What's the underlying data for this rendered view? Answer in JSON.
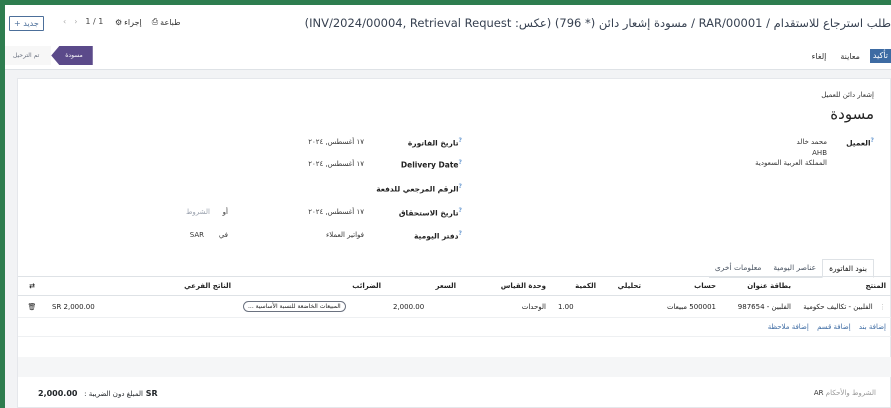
{
  "header": {
    "breadcrumb": "طلب استرجاع للاستقدام / RAR/00001 / مسودة إشعار دائن (* 796) (عكس: INV/2024/00004, Retrieval Request)",
    "new_label": "جديد",
    "pager": "1 / 1",
    "print_label": "طباعة",
    "action_label": "إجراء"
  },
  "buttons": {
    "confirm": "تأكيد",
    "preview": "معاينة",
    "cancel": "إلغاء"
  },
  "status": {
    "draft": "مسودة",
    "posted": "تم الترحيل"
  },
  "doc": {
    "type": "إشعار دائن للعميل",
    "title": "مسودة"
  },
  "customer": {
    "label": "العميل",
    "name": "محمد خالد",
    "line2": "AHB",
    "line3": "المملكة العربية السعودية"
  },
  "fields": {
    "invoice_date_label": "تاريخ الفاتورة",
    "invoice_date": "١٧ أغسطس, ٢٠٢٤",
    "delivery_label": "Delivery Date",
    "delivery": "١٧ أغسطس, ٢٠٢٤",
    "payment_ref_label": "الرقم المرجعي للدفعة",
    "due_label": "تاريخ الاستحقاق",
    "due": "١٧ أغسطس, ٢٠٢٤",
    "due_or": "أو",
    "due_terms": "الشروط",
    "journal_label": "دفتر اليومية",
    "journal": "فواتير العملاء",
    "journal_in": "في",
    "currency": "SAR"
  },
  "tabs": [
    "بنود الفاتورة",
    "عناصر اليومية",
    "معلومات أخرى"
  ],
  "table": {
    "headers": [
      "المنتج",
      "بطاقة عنوان",
      "حساب",
      "تحليلي",
      "الكمية",
      "وحدة القياس",
      "السعر",
      "الضرائب",
      "الناتج الفرعي"
    ],
    "row": {
      "product": "الفلبين - تكاليف حكومية",
      "label": "الفلبين - 987654",
      "account": "500001 مبيعات",
      "analytic": "",
      "qty": "1.00",
      "uom": "الوحدات",
      "price": "2,000.00",
      "taxes": "المبيعات الخاضعة للنسبة الأساسية ...",
      "subtotal": "2,000.00 SR"
    },
    "add_line": "إضافة بند",
    "add_section": "إضافة قسم",
    "add_note": "إضافة ملاحظة"
  },
  "footer": {
    "untaxed_label": "المبلغ دون الضريبة :",
    "untaxed": "2,000.00 SR",
    "terms_prefix": "AR",
    "terms_label": "الشروط والأحكام"
  }
}
